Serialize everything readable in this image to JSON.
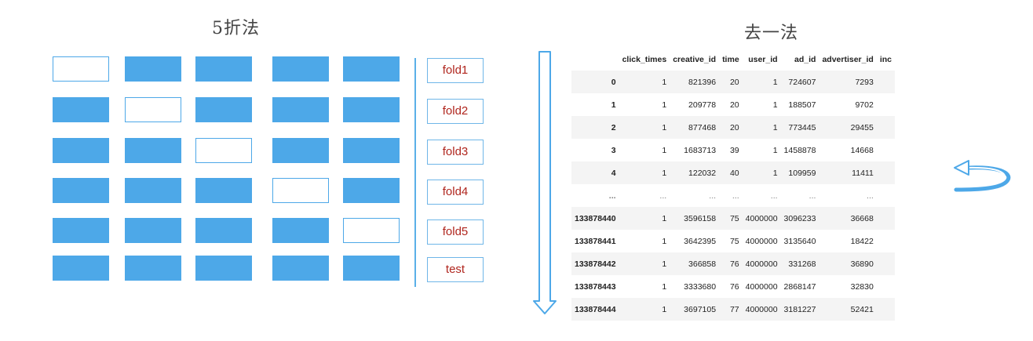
{
  "left_title": "5折法",
  "right_title": "去一法",
  "folds": [
    {
      "label": "fold1",
      "held_out": 0
    },
    {
      "label": "fold2",
      "held_out": 1
    },
    {
      "label": "fold3",
      "held_out": 2
    },
    {
      "label": "fold4",
      "held_out": 3
    },
    {
      "label": "fold5",
      "held_out": 4
    },
    {
      "label": "test",
      "held_out": null
    }
  ],
  "table": {
    "columns": [
      "",
      "click_times",
      "creative_id",
      "time",
      "user_id",
      "ad_id",
      "advertiser_id",
      "inc"
    ],
    "rows": [
      [
        "0",
        "1",
        "821396",
        "20",
        "1",
        "724607",
        "7293",
        ""
      ],
      [
        "1",
        "1",
        "209778",
        "20",
        "1",
        "188507",
        "9702",
        ""
      ],
      [
        "2",
        "1",
        "877468",
        "20",
        "1",
        "773445",
        "29455",
        ""
      ],
      [
        "3",
        "1",
        "1683713",
        "39",
        "1",
        "1458878",
        "14668",
        ""
      ],
      [
        "4",
        "1",
        "122032",
        "40",
        "1",
        "109959",
        "11411",
        ""
      ],
      [
        "...",
        "...",
        "...",
        "...",
        "...",
        "...",
        "...",
        ""
      ],
      [
        "133878440",
        "1",
        "3596158",
        "75",
        "4000000",
        "3096233",
        "36668",
        ""
      ],
      [
        "133878441",
        "1",
        "3642395",
        "75",
        "4000000",
        "3135640",
        "18422",
        ""
      ],
      [
        "133878442",
        "1",
        "366858",
        "76",
        "4000000",
        "331268",
        "36890",
        ""
      ],
      [
        "133878443",
        "1",
        "3333680",
        "76",
        "4000000",
        "2868147",
        "32830",
        ""
      ],
      [
        "133878444",
        "1",
        "3697105",
        "77",
        "4000000",
        "3181227",
        "52421",
        ""
      ]
    ]
  },
  "colors": {
    "block": "#4da8e8",
    "fold_text": "#b0261e",
    "arrow": "#4da8e8"
  }
}
